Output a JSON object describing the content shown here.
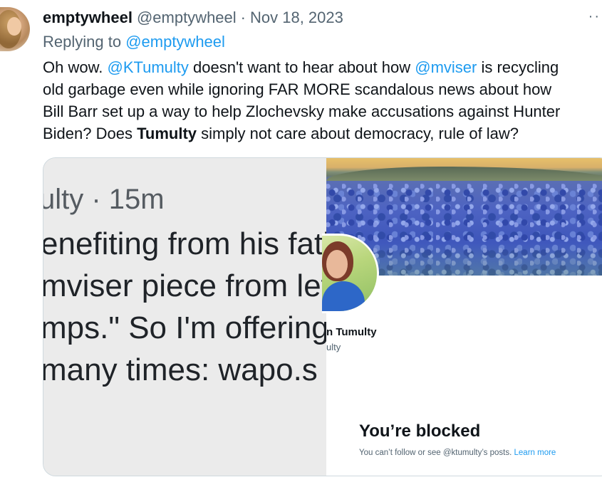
{
  "tweet": {
    "author_name": "emptywheel",
    "author_handle": "@emptywheel",
    "separator": "·",
    "date": "Nov 18, 2023",
    "more_label": "··",
    "replying_prefix": "Replying to ",
    "replying_handle": "@emptywheel",
    "body": {
      "l1_a": "Oh wow. ",
      "l1_mention1": "@KTumulty",
      "l1_b": " doesn't want to hear about how ",
      "l1_mention2": "@mviser",
      "l1_c": " is recycling",
      "l2": "old garbage even while ignoring FAR MORE scandalous news about how",
      "l3": "Bill Barr set up a way to help Zlochevsky make accusations against Hunter",
      "l4_a": "Biden? Does ",
      "l4_bold": "Tumulty",
      "l4_b": " simply not care about democracy, rule of law?"
    }
  },
  "media": {
    "zoomed_tweet": {
      "header": "ulty · 15m",
      "lines": [
        "enefiting from his fatl",
        "mviser piece from lef",
        "mps.\" So I'm offering",
        " many times: wapo.s"
      ]
    },
    "profile": {
      "name_fragment": "n Tumulty",
      "handle_fragment": "ulty",
      "blocked_title": "You’re blocked",
      "blocked_text": "You can’t follow or see @ktumulty’s posts. ",
      "learn_more": "Learn more"
    }
  },
  "icons": {
    "more": "more-icon",
    "author_avatar": "avatar-image",
    "profile_avatar": "profile-avatar-image",
    "banner": "bluebonnet-field-banner"
  },
  "colors": {
    "link": "#1d9bf0",
    "secondary_text": "#536471",
    "primary_text": "#0f1419"
  }
}
